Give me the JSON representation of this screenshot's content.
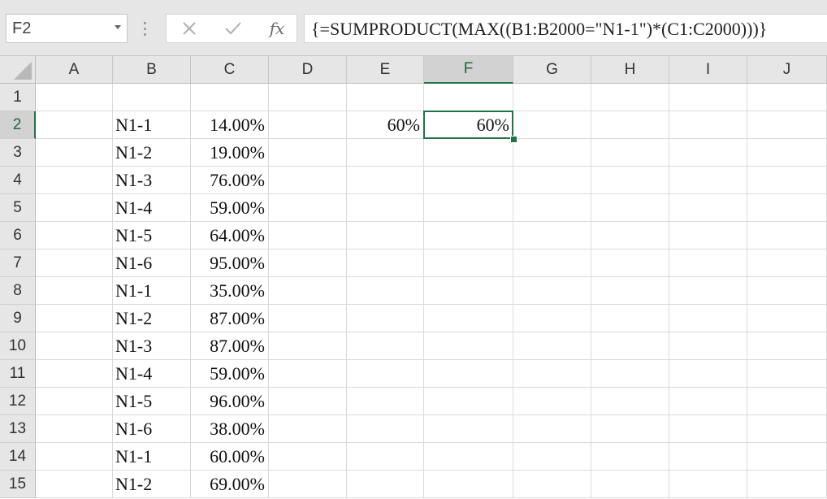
{
  "formula_bar": {
    "name_box": "F2",
    "cancel_icon": "close-icon",
    "enter_icon": "check-icon",
    "fx_label": "fx",
    "formula": "{=SUMPRODUCT(MAX((B1:B2000=\"N1-1\")*(C1:C2000)))}"
  },
  "sheet": {
    "active_cell": "F2",
    "accent_color": "#217346",
    "columns": [
      "A",
      "B",
      "C",
      "D",
      "E",
      "F",
      "G",
      "H",
      "I",
      "J"
    ],
    "rows": [
      "1",
      "2",
      "3",
      "4",
      "5",
      "6",
      "7",
      "8",
      "9",
      "10",
      "11",
      "12",
      "13",
      "14",
      "15"
    ],
    "cells": {
      "B2": "N1-1",
      "C2": "14.00%",
      "E2": "60%",
      "F2": "60%",
      "B3": "N1-2",
      "C3": "19.00%",
      "B4": "N1-3",
      "C4": "76.00%",
      "B5": "N1-4",
      "C5": "59.00%",
      "B6": "N1-5",
      "C6": "64.00%",
      "B7": "N1-6",
      "C7": "95.00%",
      "B8": "N1-1",
      "C8": "35.00%",
      "B9": "N1-2",
      "C9": "87.00%",
      "B10": "N1-3",
      "C10": "87.00%",
      "B11": "N1-4",
      "C11": "59.00%",
      "B12": "N1-5",
      "C12": "96.00%",
      "B13": "N1-6",
      "C13": "38.00%",
      "B14": "N1-1",
      "C14": "60.00%",
      "B15": "N1-2",
      "C15": "69.00%"
    }
  }
}
